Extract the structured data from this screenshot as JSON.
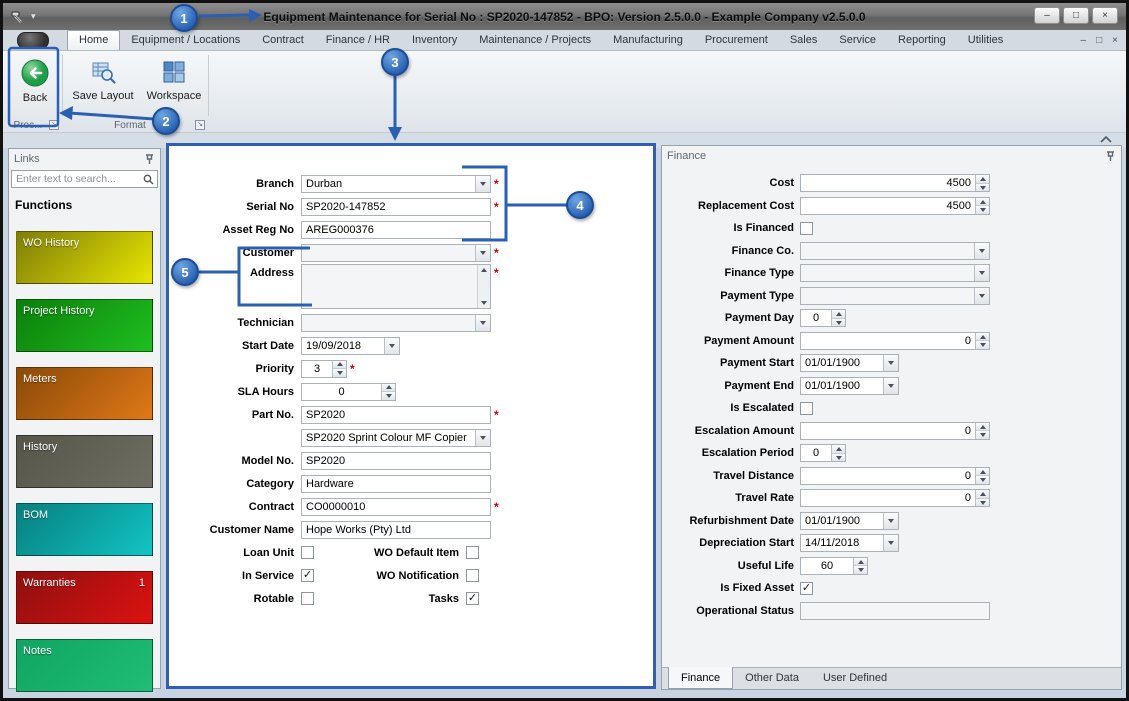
{
  "window": {
    "title": "Equipment Maintenance for Serial No : SP2020-147852 - BPO: Version 2.5.0.0 - Example Company v2.5.0.0"
  },
  "icons": {
    "minimize": "–",
    "maximize": "□",
    "close": "×",
    "mdi_minimize": "–",
    "mdi_restore": "□",
    "mdi_close": "×",
    "titlebar_chevron": "▾",
    "launcher_arrow": "↘"
  },
  "ribbon": {
    "tabs": [
      "Home",
      "Equipment / Locations",
      "Contract",
      "Finance / HR",
      "Inventory",
      "Maintenance / Projects",
      "Manufacturing",
      "Procurement",
      "Sales",
      "Service",
      "Reporting",
      "Utilities"
    ],
    "active_tab": "Home",
    "buttons": [
      {
        "label": "Back"
      },
      {
        "label": "Save Layout"
      },
      {
        "label": "Workspace"
      }
    ],
    "groups": [
      "Proc...",
      "Format"
    ]
  },
  "links_panel": {
    "title": "Links",
    "search_placeholder": "Enter text to search...",
    "heading": "Functions",
    "items": [
      {
        "label": "WO History",
        "badge": "",
        "color_from": "#7e7e08",
        "color_to": "#e8e500"
      },
      {
        "label": "Project History",
        "badge": "",
        "color_from": "#0b7f0b",
        "color_to": "#1fbf1f"
      },
      {
        "label": "Meters",
        "badge": "",
        "color_from": "#8a4a08",
        "color_to": "#e07818"
      },
      {
        "label": "History",
        "badge": "",
        "color_from": "#55554a",
        "color_to": "#6e6e62"
      },
      {
        "label": "BOM",
        "badge": "",
        "color_from": "#087f7f",
        "color_to": "#12c4c4"
      },
      {
        "label": "Warranties",
        "badge": "1",
        "color_from": "#8f1010",
        "color_to": "#dd1111"
      },
      {
        "label": "Notes",
        "badge": "",
        "color_from": "#10a562",
        "color_to": "#1fbd75"
      }
    ]
  },
  "form": {
    "fields": [
      {
        "label": "Branch",
        "value": "Durban",
        "type": "combo",
        "size": "lg",
        "required": true
      },
      {
        "label": "Serial No",
        "value": "SP2020-147852",
        "type": "text",
        "size": "lg",
        "required": true
      },
      {
        "label": "Asset Reg No",
        "value": "AREG000376",
        "type": "text",
        "size": "lg"
      },
      {
        "label": "Customer",
        "value": "",
        "type": "combo",
        "size": "lg",
        "required": true
      },
      {
        "label": "Address",
        "value": "",
        "type": "memo",
        "size": "lg",
        "required": true
      },
      {
        "label": "Technician",
        "value": "",
        "type": "combo",
        "size": "lg"
      },
      {
        "label": "Start Date",
        "value": "19/09/2018",
        "type": "date",
        "size": "date"
      },
      {
        "label": "Priority",
        "value": "3",
        "type": "spin",
        "size": "xs",
        "required": true
      },
      {
        "label": "SLA Hours",
        "value": "0",
        "type": "spin",
        "size": "md"
      },
      {
        "label": "Part No.",
        "value": "SP2020",
        "type": "text",
        "size": "lg",
        "required": true
      },
      {
        "label": "",
        "value": "SP2020 Sprint Colour MF Copier",
        "type": "combo",
        "size": "lg"
      },
      {
        "label": "Model No.",
        "value": "SP2020",
        "type": "text",
        "size": "lg"
      },
      {
        "label": "Category",
        "value": "Hardware",
        "type": "text",
        "size": "lg"
      },
      {
        "label": "Contract",
        "value": "CO0000010",
        "type": "text",
        "size": "lg",
        "required": true
      },
      {
        "label": "Customer Name",
        "value": "Hope Works (Pty) Ltd",
        "type": "text",
        "size": "lg"
      },
      {
        "type": "checkrow",
        "items": [
          {
            "label": "Loan Unit",
            "checked": false
          },
          {
            "label": "WO Default Item",
            "checked": false
          }
        ]
      },
      {
        "type": "checkrow",
        "items": [
          {
            "label": "In Service",
            "checked": true
          },
          {
            "label": "WO Notification",
            "checked": false
          }
        ]
      },
      {
        "type": "checkrow",
        "items": [
          {
            "label": "Rotable",
            "checked": false
          },
          {
            "label": "Tasks",
            "checked": true
          }
        ]
      }
    ]
  },
  "finance": {
    "title": "Finance",
    "fields": [
      {
        "label": "Cost",
        "value": "4500",
        "type": "spin",
        "size": "lg"
      },
      {
        "label": "Replacement Cost",
        "value": "4500",
        "type": "spin",
        "size": "lg"
      },
      {
        "label": "Is Financed",
        "type": "check",
        "checked": false
      },
      {
        "label": "Finance Co.",
        "value": "",
        "type": "combo",
        "size": "lg"
      },
      {
        "label": "Finance Type",
        "value": "",
        "type": "combo",
        "size": "lg"
      },
      {
        "label": "Payment Type",
        "value": "",
        "type": "combo",
        "size": "lg"
      },
      {
        "label": "Payment Day",
        "value": "0",
        "type": "spin",
        "size": "xs"
      },
      {
        "label": "Payment Amount",
        "value": "0",
        "type": "spin",
        "size": "lg"
      },
      {
        "label": "Payment Start",
        "value": "01/01/1900",
        "type": "date",
        "size": "date"
      },
      {
        "label": "Payment End",
        "value": "01/01/1900",
        "type": "date",
        "size": "date"
      },
      {
        "label": "Is Escalated",
        "type": "check",
        "checked": false
      },
      {
        "label": "Escalation Amount",
        "value": "0",
        "type": "spin",
        "size": "lg"
      },
      {
        "label": "Escalation Period",
        "value": "0",
        "type": "spin",
        "size": "xs"
      },
      {
        "label": "Travel Distance",
        "value": "0",
        "type": "spin",
        "size": "lg"
      },
      {
        "label": "Travel Rate",
        "value": "0",
        "type": "spin",
        "size": "lg"
      },
      {
        "label": "Refurbishment Date",
        "value": "01/01/1900",
        "type": "date",
        "size": "date"
      },
      {
        "label": "Depreciation Start",
        "value": "14/11/2018",
        "type": "date",
        "size": "date"
      },
      {
        "label": "Useful Life",
        "value": "60",
        "type": "spin",
        "size": "sm"
      },
      {
        "label": "Is Fixed Asset",
        "type": "check",
        "checked": true
      },
      {
        "label": "Operational Status",
        "value": "",
        "type": "text",
        "size": "lg"
      }
    ],
    "tabs": [
      "Finance",
      "Other Data",
      "User Defined"
    ],
    "active_tab": "Finance"
  },
  "annotations": {
    "numbers": [
      "1",
      "2",
      "3",
      "4",
      "5"
    ],
    "accent_color": "#2a5fb4"
  }
}
